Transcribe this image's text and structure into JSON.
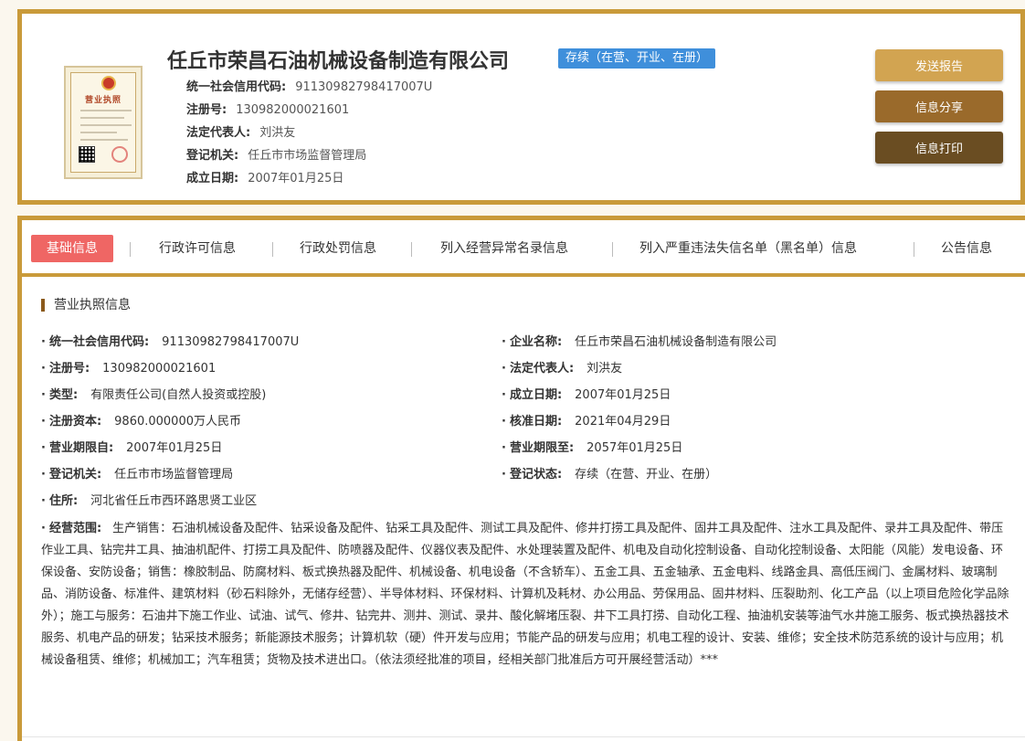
{
  "header": {
    "company_name": "任丘市荣昌石油机械设备制造有限公司",
    "status_badge": "存续（在营、开业、在册）",
    "license_thumb_title": "营业执照",
    "fields": [
      {
        "label": "统一社会信用代码:",
        "value": "91130982798417007U"
      },
      {
        "label": "注册号:",
        "value": "130982000021601"
      },
      {
        "label": "法定代表人:",
        "value": "刘洪友"
      },
      {
        "label": "登记机关:",
        "value": "任丘市市场监督管理局"
      },
      {
        "label": "成立日期:",
        "value": "2007年01月25日"
      }
    ],
    "buttons": {
      "send": "发送报告",
      "share": "信息分享",
      "print": "信息打印"
    }
  },
  "tabs": [
    {
      "label": "基础信息",
      "active": true
    },
    {
      "label": "行政许可信息",
      "active": false
    },
    {
      "label": "行政处罚信息",
      "active": false
    },
    {
      "label": "列入经营异常名录信息",
      "active": false
    },
    {
      "label": "列入严重违法失信名单（黑名单）信息",
      "active": false
    },
    {
      "label": "公告信息",
      "active": false
    }
  ],
  "section": {
    "title": "营业执照信息",
    "left": [
      {
        "label": "统一社会信用代码:",
        "value": "91130982798417007U"
      },
      {
        "label": "注册号:",
        "value": "130982000021601"
      },
      {
        "label": "类型:",
        "value": "有限责任公司(自然人投资或控股)"
      },
      {
        "label": "注册资本:",
        "value": "9860.000000万人民币"
      },
      {
        "label": "营业期限自:",
        "value": "2007年01月25日"
      },
      {
        "label": "登记机关:",
        "value": "任丘市市场监督管理局"
      },
      {
        "label": "住所:",
        "value": "河北省任丘市西环路思贤工业区"
      }
    ],
    "right": [
      {
        "label": "企业名称:",
        "value": "任丘市荣昌石油机械设备制造有限公司"
      },
      {
        "label": "法定代表人:",
        "value": "刘洪友"
      },
      {
        "label": "成立日期:",
        "value": "2007年01月25日"
      },
      {
        "label": "核准日期:",
        "value": "2021年04月29日"
      },
      {
        "label": "营业期限至:",
        "value": "2057年01月25日"
      },
      {
        "label": "登记状态:",
        "value": "存续（在营、开业、在册）"
      }
    ],
    "scope": {
      "label": "经营范围:",
      "value": "生产销售：石油机械设备及配件、钻采设备及配件、钻采工具及配件、测试工具及配件、修井打捞工具及配件、固井工具及配件、注水工具及配件、录井工具及配件、带压作业工具、钻完井工具、抽油机配件、打捞工具及配件、防喷器及配件、仪器仪表及配件、水处理装置及配件、机电及自动化控制设备、自动化控制设备、太阳能（风能）发电设备、环保设备、安防设备；销售：橡胶制品、防腐材料、板式换热器及配件、机械设备、机电设备（不含轿车）、五金工具、五金轴承、五金电料、线路金具、高低压阀门、金属材料、玻璃制品、消防设备、标准件、建筑材料（砂石料除外，无储存经营）、半导体材料、环保材料、计算机及耗材、办公用品、劳保用品、固井材料、压裂助剂、化工产品（以上项目危险化学品除外）；施工与服务：石油井下施工作业、试油、试气、修井、钻完井、测井、测试、录井、酸化解堵压裂、井下工具打捞、自动化工程、抽油机安装等油气水井施工服务、板式换热器技术服务、机电产品的研发；钻采技术服务；新能源技术服务；计算机软（硬）件开发与应用；节能产品的研发与应用；机电工程的设计、安装、维修；安全技术防范系统的设计与应用；机械设备租赁、维修；机械加工；汽车租赁；货物及技术进出口。（依法须经批准的项目，经相关部门批准后方可开展经营活动）***"
    }
  },
  "colors": {
    "border": "#c99a3a",
    "badge": "#3f8fdb",
    "active_tab": "#ef6664",
    "btn_send": "#d2a451",
    "btn_share": "#9a6a2b",
    "btn_print": "#6a4d22"
  }
}
